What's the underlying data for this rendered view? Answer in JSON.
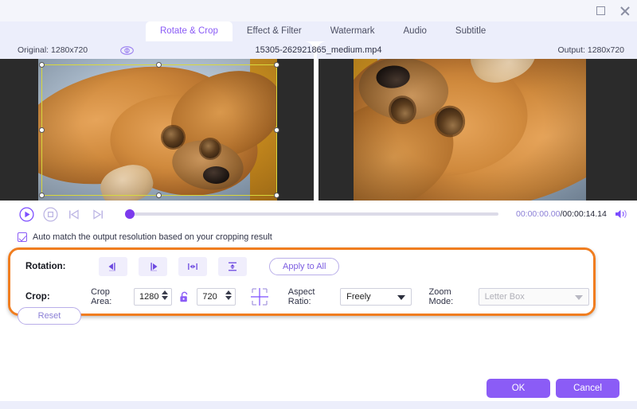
{
  "window": {
    "controls": [
      {
        "name": "maximize",
        "label": "□"
      },
      {
        "name": "close",
        "label": "✕"
      }
    ]
  },
  "tabs": [
    {
      "label": "Rotate & Crop",
      "active": true
    },
    {
      "label": "Effect & Filter",
      "active": false
    },
    {
      "label": "Watermark",
      "active": false
    },
    {
      "label": "Audio",
      "active": false
    },
    {
      "label": "Subtitle",
      "active": false
    }
  ],
  "infobar": {
    "original_label": "Original: 1280x720",
    "filename": "15305-262921865_medium.mp4",
    "output_label": "Output: 1280x720",
    "eye_icon": "eye-icon"
  },
  "player": {
    "play_icon": "play-circle-icon",
    "stop_icon": "stop-circle-icon",
    "prev_icon": "previous-frame-icon",
    "next_icon": "next-frame-icon",
    "current_time": "00:00:00.00",
    "separator": "/",
    "total_time": "00:00:14.14",
    "volume_icon": "volume-icon",
    "progress_percent": 0
  },
  "auto_match": {
    "label": "Auto match the output resolution based on your cropping result",
    "checked": true
  },
  "rotation": {
    "label": "Rotation:",
    "buttons": [
      {
        "name": "rotate-left-icon",
        "title": "Rotate Left"
      },
      {
        "name": "rotate-right-icon",
        "title": "Rotate Right"
      },
      {
        "name": "flip-horizontal-icon",
        "title": "Flip Horizontal"
      },
      {
        "name": "flip-vertical-icon",
        "title": "Flip Vertical"
      }
    ],
    "apply_to_all": "Apply to All"
  },
  "crop": {
    "label": "Crop:",
    "crop_area_label": "Crop Area:",
    "width": "1280",
    "height": "720",
    "lock_icon": "unlock-icon",
    "position_icon": "crop-position-icon",
    "aspect_ratio_label": "Aspect Ratio:",
    "aspect_ratio_value": "Freely",
    "zoom_mode_label": "Zoom Mode:",
    "zoom_mode_value": "Letter Box"
  },
  "reset": {
    "label": "Reset"
  },
  "footer": {
    "ok_label": "OK",
    "cancel_label": "Cancel"
  },
  "colors": {
    "accent": "#8b5cf6",
    "tab_strip": "#eceefb",
    "highlight": "#f07d1f",
    "crop_border": "#d8d83c"
  }
}
